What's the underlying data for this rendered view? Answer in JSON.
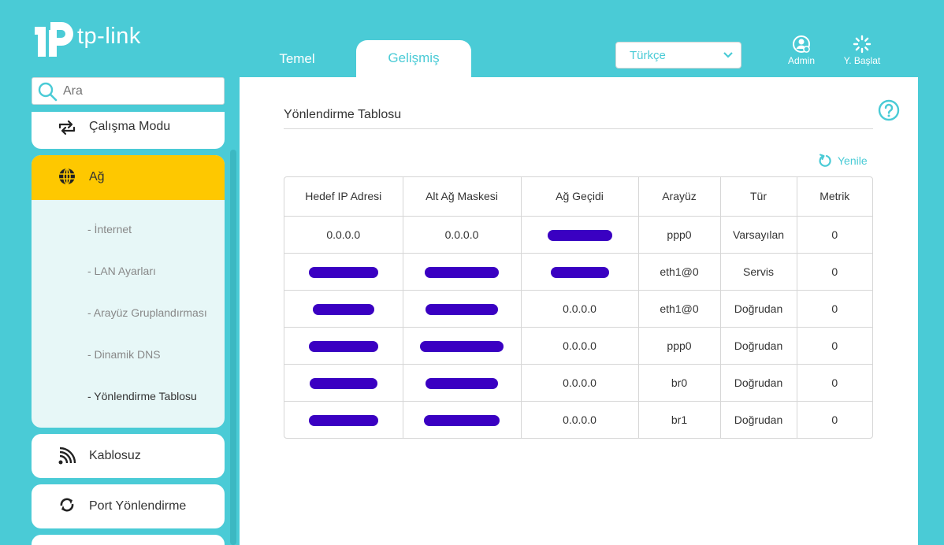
{
  "brand": {
    "logo_text": "tp-link"
  },
  "tabs": [
    {
      "label": "Temel",
      "active": false
    },
    {
      "label": "Gelişmiş",
      "active": true
    }
  ],
  "language": {
    "selected": "Türkçe"
  },
  "header_buttons": {
    "admin": "Admin",
    "setup": "Y. Başlat"
  },
  "search": {
    "placeholder": "Ara"
  },
  "sidebar": {
    "mode": "Çalışma Modu",
    "network": "Ağ",
    "network_sub": [
      "- İnternet",
      "- LAN Ayarları",
      "- Arayüz Gruplandırması",
      "- Dinamik DNS",
      "- Yönlendirme Tablosu"
    ],
    "network_sub_active": 4,
    "wireless": "Kablosuz",
    "port_forwarding": "Port Yönlendirme"
  },
  "page": {
    "title": "Yönlendirme Tablosu",
    "refresh": "Yenile"
  },
  "table": {
    "headers": [
      "Hedef IP Adresi",
      "Alt Ağ Maskesi",
      "Ağ Geçidi",
      "Arayüz",
      "Tür",
      "Metrik"
    ],
    "rows": [
      [
        "0.0.0.0",
        "0.0.0.0",
        "",
        "ppp0",
        "Varsayılan",
        "0"
      ],
      [
        "",
        "",
        "",
        "eth1@0",
        "Servis",
        "0"
      ],
      [
        "",
        "",
        "0.0.0.0",
        "eth1@0",
        "Doğrudan",
        "0"
      ],
      [
        "",
        "",
        "0.0.0.0",
        "ppp0",
        "Doğrudan",
        "0"
      ],
      [
        "",
        "",
        "0.0.0.0",
        "br0",
        "Doğrudan",
        "0"
      ],
      [
        "",
        "",
        "0.0.0.0",
        "br1",
        "Doğrudan",
        "0"
      ]
    ]
  },
  "colors": {
    "accent": "#4acbd6",
    "highlight": "#fec800",
    "redaction": "#3a00c2"
  },
  "icons": {
    "search": "search-icon",
    "mode": "swap-icon",
    "network": "globe-icon",
    "wireless": "wifi-icon",
    "port": "sync-icon",
    "admin": "user-icon",
    "setup": "spinner-icon",
    "help": "help-icon",
    "refresh": "refresh-icon"
  }
}
